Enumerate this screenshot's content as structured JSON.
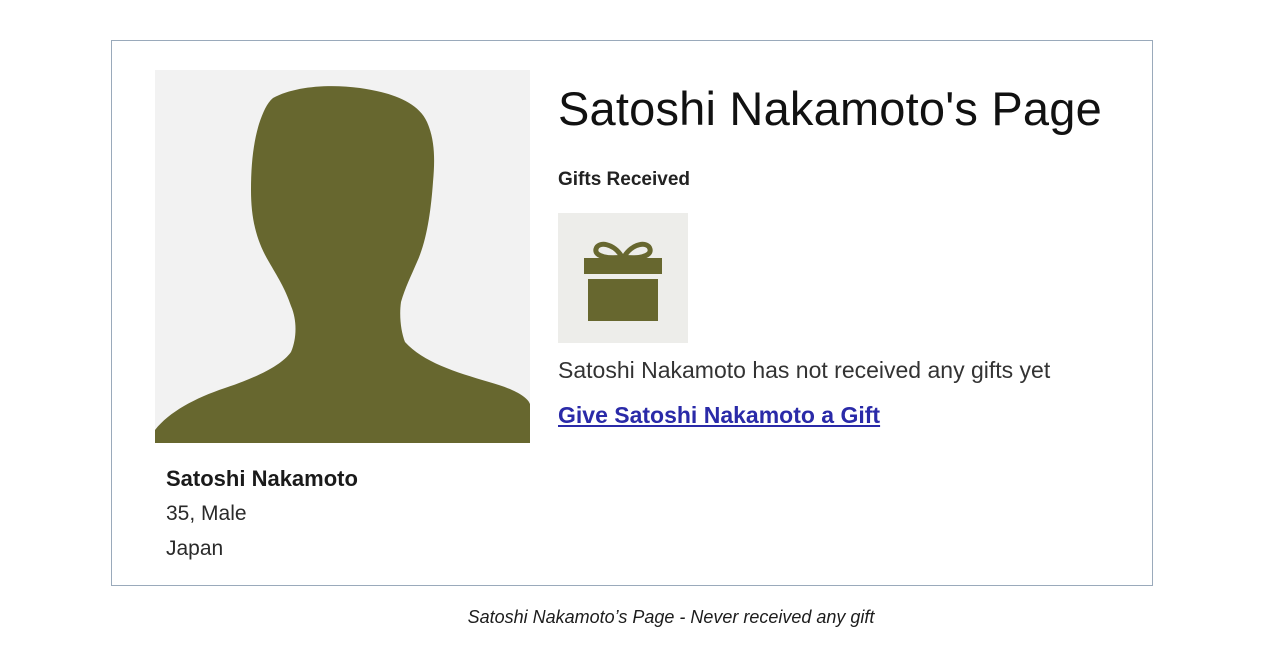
{
  "page": {
    "title": "Satoshi Nakamoto's Page",
    "caption": "Satoshi Nakamoto’s Page - Never received any gift"
  },
  "profile": {
    "name": "Satoshi Nakamoto",
    "age_gender": "35, Male",
    "country": "Japan",
    "avatar_icon": "person-silhouette-icon",
    "avatar_color": "#67672f"
  },
  "gifts": {
    "heading": "Gifts Received",
    "icon": "gift-icon",
    "icon_color": "#67672f",
    "empty_message": "Satoshi Nakamoto has not received any gifts yet",
    "give_link": "Give Satoshi Nakamoto a Gift",
    "link_color": "#2a2aa8"
  }
}
